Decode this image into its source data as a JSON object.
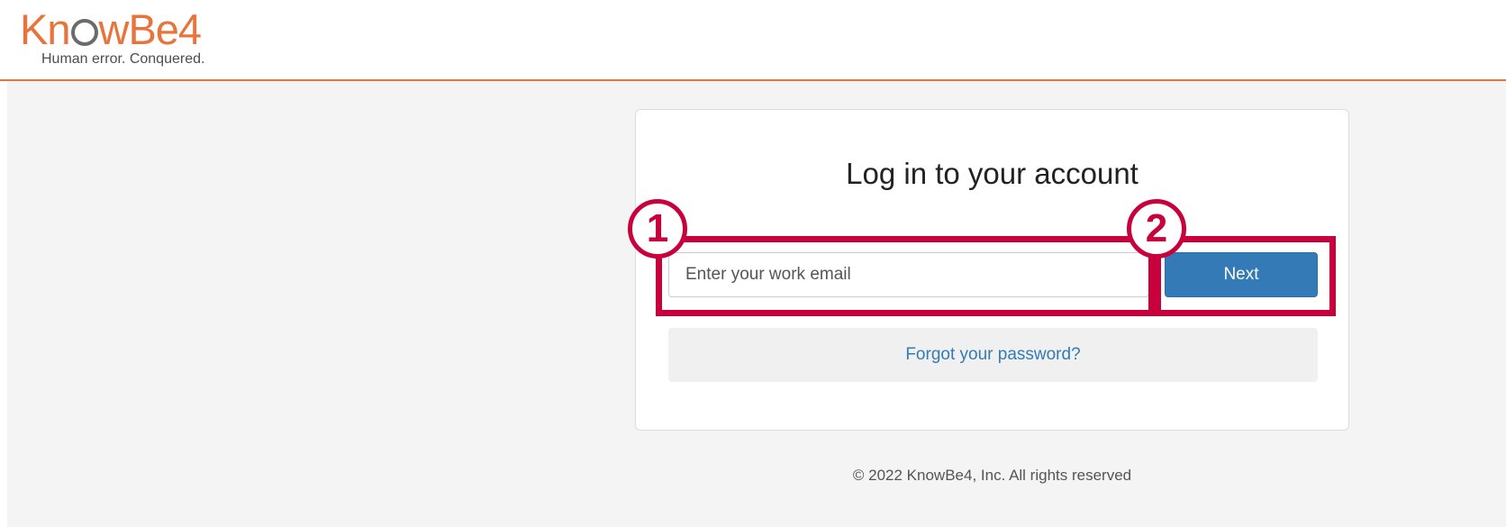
{
  "brand": {
    "logo_text_prefix": "Kn",
    "logo_text_suffix": "wBe4",
    "tagline": "Human error. Conquered.",
    "accent_color": "#e8743b"
  },
  "login": {
    "title": "Log in to your account",
    "email_placeholder": "Enter your work email",
    "email_value": "",
    "next_label": "Next",
    "forgot_password_label": "Forgot your password?",
    "primary_color": "#337ab7"
  },
  "footer": {
    "copyright": "© 2022 KnowBe4, Inc. All rights reserved"
  },
  "annotations": {
    "callout_1": "1",
    "callout_2": "2",
    "highlight_color": "#c8003c"
  }
}
